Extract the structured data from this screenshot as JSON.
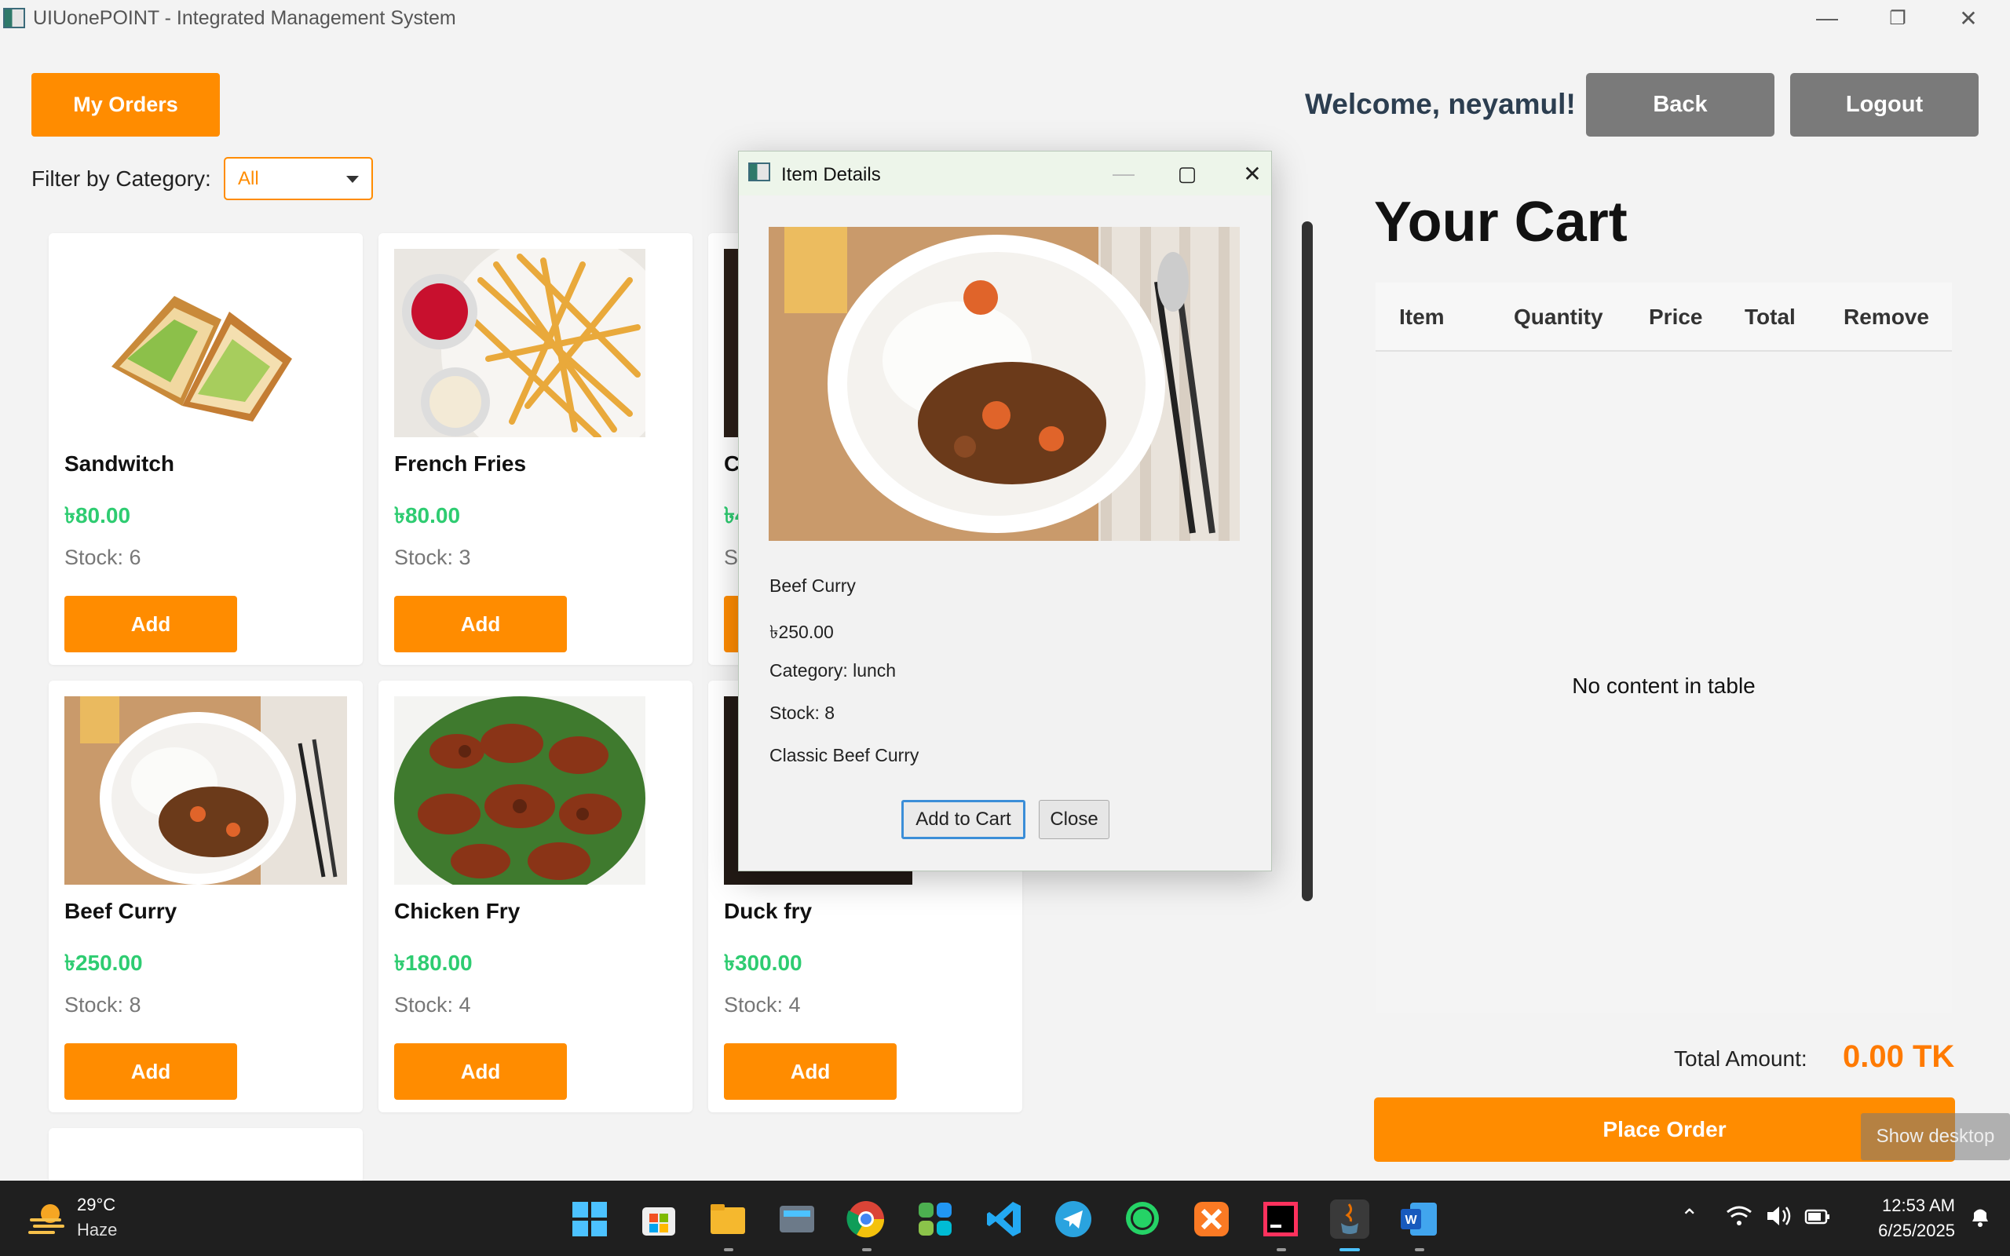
{
  "window": {
    "title": "UIUonePOINT - Integrated Management System",
    "minimize": "—",
    "restore": "❐",
    "close": "✕"
  },
  "header": {
    "my_orders": "My Orders",
    "welcome": "Welcome, neyamul!",
    "back": "Back",
    "logout": "Logout"
  },
  "filter": {
    "label": "Filter by Category:",
    "selected": "All"
  },
  "products": [
    {
      "name": "Sandwitch",
      "price": "৳80.00",
      "stock": "Stock: 6",
      "add": "Add"
    },
    {
      "name": "French Fries",
      "price": "৳80.00",
      "stock": "Stock: 3",
      "add": "Add"
    },
    {
      "name": "C",
      "price": "৳4",
      "stock": "St",
      "add": ""
    },
    {
      "name": "Beef Curry",
      "price": "৳250.00",
      "stock": "Stock: 8",
      "add": "Add"
    },
    {
      "name": "Chicken Fry",
      "price": "৳180.00",
      "stock": "Stock: 4",
      "add": "Add"
    },
    {
      "name": "Duck fry",
      "price": "৳300.00",
      "stock": "Stock: 4",
      "add": "Add"
    }
  ],
  "dialog": {
    "title": "Item Details",
    "name": "Beef Curry",
    "price": "৳250.00",
    "category": "Category: lunch",
    "stock": "Stock: 8",
    "description": "Classic Beef Curry",
    "add_to_cart": "Add to Cart",
    "close": "Close"
  },
  "cart": {
    "title": "Your Cart",
    "columns": [
      "Item",
      "Quantity",
      "Price",
      "Total",
      "Remove"
    ],
    "empty": "No content in table",
    "total_label": "Total Amount:",
    "total_value": "0.00 TK",
    "place_order": "Place Order"
  },
  "show_desktop": "Show desktop",
  "taskbar": {
    "temperature": "29°C",
    "weather": "Haze",
    "time": "12:53 AM",
    "date": "6/25/2025"
  },
  "colors": {
    "accent": "#ff8c00",
    "price": "#2ecc71",
    "gray_button": "#7a7a7a"
  }
}
